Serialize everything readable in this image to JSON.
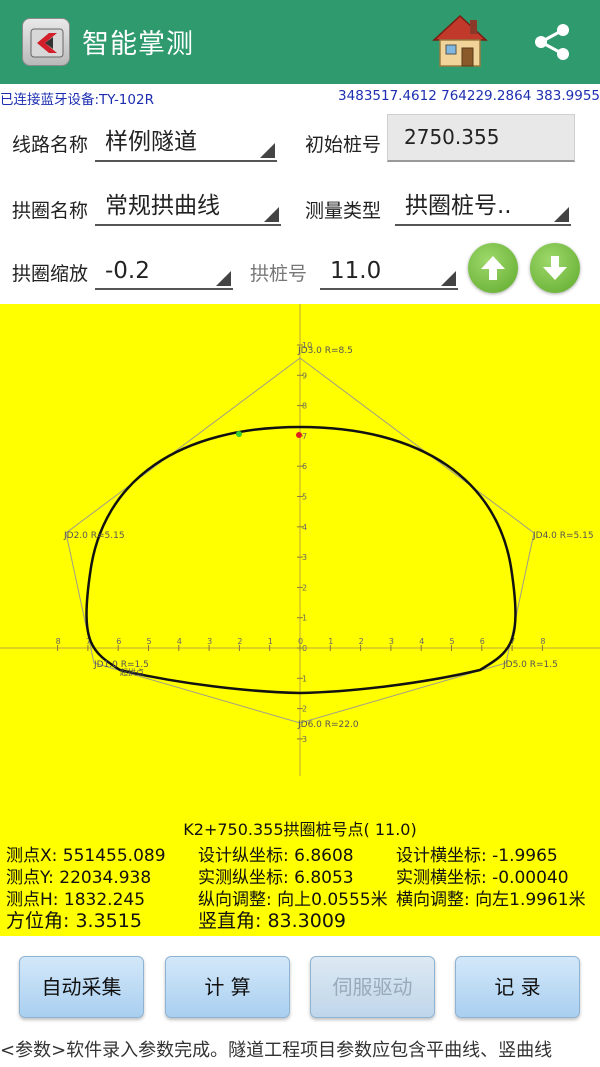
{
  "app": {
    "title": "智能掌测"
  },
  "status": {
    "bluetooth": "已连接蓝牙设备:TY-102R",
    "coords": "3483517.4612 764229.2864 383.9955"
  },
  "form": {
    "route_label": "线路名称",
    "route_value": "样例隧道",
    "start_chainage_label": "初始桩号",
    "start_chainage_value": "2750.355",
    "arch_label": "拱圈名称",
    "arch_value": "常规拱曲线",
    "measure_type_label": "测量类型",
    "measure_type_value": "拱圈桩号..",
    "scale_label": "拱圈缩放",
    "scale_value": "-0.2",
    "arch_pile_label": "拱桩号",
    "arch_pile_value": "11.0"
  },
  "plot": {
    "x_ticks": [
      "8",
      "7",
      "6",
      "5",
      "4",
      "3",
      "2",
      "1",
      "0",
      "1",
      "2",
      "3",
      "4",
      "5",
      "6",
      "7",
      "8"
    ],
    "y_ticks": [
      "10",
      "9",
      "8",
      "7",
      "6",
      "5",
      "4",
      "3",
      "2",
      "1",
      "0",
      "1",
      "2",
      "3"
    ],
    "labels": {
      "jd3": "JD3.0  R=8.5",
      "jd2": "JD2.0  R=5.15",
      "jd4": "JD4.0  R=5.15",
      "jd1": "JD1.0  R=1.5",
      "jd5": "JD5.0  R=1.5",
      "jd6": "JD6.0  R=22.0",
      "origin": "起拱点"
    },
    "colors": {
      "background": "#ffff00",
      "curve": "#111111",
      "measured_point": "#e02020",
      "design_point": "#33cc33"
    }
  },
  "results": {
    "caption": "K2+750.355拱圈桩号点( 11.0)",
    "x": "测点X: 551455.089",
    "y": "测点Y: 22034.938",
    "h": "测点H: 1832.245",
    "azimuth": "方位角: 3.3515",
    "design_vert": "设计纵坐标: 6.8608",
    "meas_vert": "实测纵坐标: 6.8053",
    "vert_adjust": "纵向调整: 向上0.0555米",
    "vert_angle": "竖直角: 83.3009",
    "design_horiz": "设计横坐标: -1.9965",
    "meas_horiz": "实测横坐标: -0.00040",
    "horiz_adjust": "横向调整: 向左1.9961米"
  },
  "buttons": {
    "auto_collect": "自动采集",
    "calculate": "计 算",
    "servo_drive": "伺服驱动",
    "record": "记 录"
  },
  "ticker": "<参数>软件录入参数完成。隧道工程项目参数应包含平曲线、竖曲线"
}
